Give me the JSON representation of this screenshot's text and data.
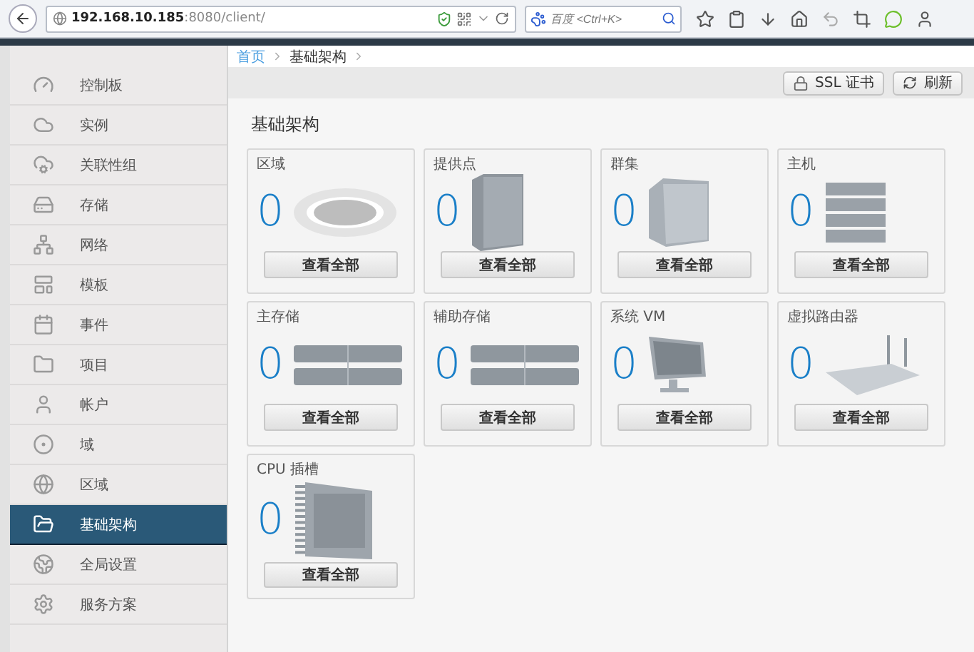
{
  "browser": {
    "url_host": "192.168.10.185",
    "url_path": ":8080/client/",
    "search_placeholder": "百度 <Ctrl+K>"
  },
  "sidebar": {
    "items": [
      {
        "label": "控制板",
        "selected": false
      },
      {
        "label": "实例",
        "selected": false
      },
      {
        "label": "关联性组",
        "selected": false
      },
      {
        "label": "存储",
        "selected": false
      },
      {
        "label": "网络",
        "selected": false
      },
      {
        "label": "模板",
        "selected": false
      },
      {
        "label": "事件",
        "selected": false
      },
      {
        "label": "项目",
        "selected": false
      },
      {
        "label": "帐户",
        "selected": false
      },
      {
        "label": "域",
        "selected": false
      },
      {
        "label": "区域",
        "selected": false
      },
      {
        "label": "基础架构",
        "selected": true
      },
      {
        "label": "全局设置",
        "selected": false
      },
      {
        "label": "服务方案",
        "selected": false
      }
    ]
  },
  "breadcrumb": [
    {
      "label": "首页"
    },
    {
      "label": "基础架构"
    }
  ],
  "toolbar": {
    "buttons": [
      {
        "label": "SSL 证书"
      },
      {
        "label": "刷新"
      }
    ]
  },
  "panel": {
    "title": "基础架构",
    "cards": [
      {
        "title": "区域",
        "count": "0",
        "button": "查看全部"
      },
      {
        "title": "提供点",
        "count": "0",
        "button": "查看全部"
      },
      {
        "title": "群集",
        "count": "0",
        "button": "查看全部"
      },
      {
        "title": "主机",
        "count": "0",
        "button": "查看全部"
      },
      {
        "title": "主存储",
        "count": "0",
        "button": "查看全部"
      },
      {
        "title": "辅助存储",
        "count": "0",
        "button": "查看全部"
      },
      {
        "title": "系统 VM",
        "count": "0",
        "button": "查看全部"
      },
      {
        "title": "虚拟路由器",
        "count": "0",
        "button": "查看全部"
      },
      {
        "title": "CPU 插槽",
        "count": "0",
        "button": "查看全部"
      }
    ]
  }
}
